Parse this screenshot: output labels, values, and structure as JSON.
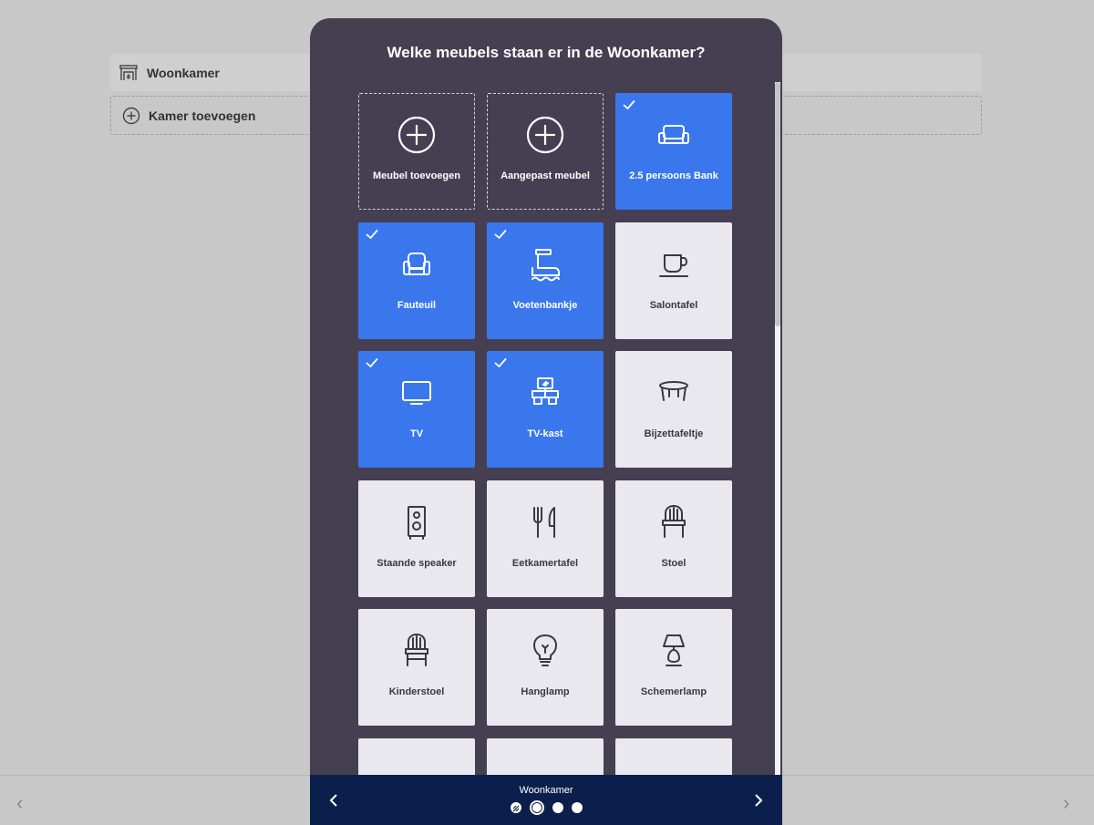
{
  "modal": {
    "title": "Welke meubels staan er in de Woonkamer?"
  },
  "background": {
    "room_label": "Woonkamer",
    "add_room_label": "Kamer toevoegen"
  },
  "tiles": [
    {
      "label": "Meubel toevoegen",
      "icon": "plus-circle-icon",
      "state": "add"
    },
    {
      "label": "Aangepast meubel",
      "icon": "plus-circle-icon",
      "state": "add"
    },
    {
      "label": "2.5 persoons Bank",
      "icon": "sofa-icon",
      "state": "selected"
    },
    {
      "label": "Fauteuil",
      "icon": "armchair-icon",
      "state": "selected"
    },
    {
      "label": "Voetenbankje",
      "icon": "footstool-icon",
      "state": "selected"
    },
    {
      "label": "Salontafel",
      "icon": "coffee-cup-icon",
      "state": "default"
    },
    {
      "label": "TV",
      "icon": "tv-icon",
      "state": "selected"
    },
    {
      "label": "TV-kast",
      "icon": "tv-cabinet-icon",
      "state": "selected"
    },
    {
      "label": "Bijzettafeltje",
      "icon": "side-table-icon",
      "state": "default"
    },
    {
      "label": "Staande speaker",
      "icon": "speaker-icon",
      "state": "default"
    },
    {
      "label": "Eetkamertafel",
      "icon": "fork-knife-icon",
      "state": "default"
    },
    {
      "label": "Stoel",
      "icon": "chair-icon",
      "state": "default"
    },
    {
      "label": "Kinderstoel",
      "icon": "high-chair-icon",
      "state": "default"
    },
    {
      "label": "Hanglamp",
      "icon": "lightbulb-icon",
      "state": "default"
    },
    {
      "label": "Schemerlamp",
      "icon": "table-lamp-icon",
      "state": "default"
    },
    {
      "label": "",
      "icon": "sideboard-icon",
      "state": "default"
    },
    {
      "label": "",
      "icon": "floor-lamp-icon",
      "state": "default"
    },
    {
      "label": "",
      "icon": "dresser-icon",
      "state": "default"
    }
  ],
  "footer": {
    "room_name": "Woonkamer",
    "steps": [
      "done",
      "active",
      "pending",
      "pending"
    ]
  },
  "colors": {
    "modal_bg": "#453f51",
    "selected_tile": "#3a77ec",
    "default_tile": "#e8e8ee",
    "footer_bg": "#0b1f4d"
  }
}
